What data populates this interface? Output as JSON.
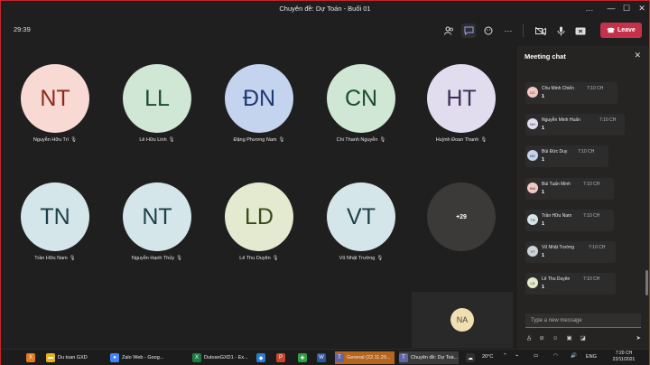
{
  "window": {
    "title": "Chuyên đề: Dự Toán - Buổi 01",
    "controls": [
      "…",
      "—",
      "☐",
      "✕"
    ]
  },
  "toolbar": {
    "timer": "29:39",
    "leave_label": "Leave",
    "icons": [
      "people-icon",
      "chat-icon",
      "reactions-icon",
      "more-icon",
      "camera-icon",
      "mic-icon",
      "share-icon"
    ]
  },
  "participants": [
    {
      "initials": "NT",
      "name": "Nguyễn Hữu Trí",
      "color": "#f9d9d3",
      "text": "#8a2b1a"
    },
    {
      "initials": "LL",
      "name": "Lê Hữu Linh",
      "color": "#cfe7d4",
      "text": "#1e4d2b"
    },
    {
      "initials": "ĐN",
      "name": "Đặng Phương Nam",
      "color": "#c4d3ee",
      "text": "#1e3a70"
    },
    {
      "initials": "CN",
      "name": "Chi Thanh Nguyễn",
      "color": "#cfe7d4",
      "text": "#1e4d2b"
    },
    {
      "initials": "HT",
      "name": "Huỳnh Đoan Thanh",
      "color": "#e1dcee",
      "text": "#3b2f5a"
    },
    {
      "initials": "TN",
      "name": "Trần Hữu Nam",
      "color": "#d5e6ea",
      "text": "#1e3f47"
    },
    {
      "initials": "NT",
      "name": "Nguyễn Hạnh Thủy",
      "color": "#d5e6ea",
      "text": "#1e3f47"
    },
    {
      "initials": "LD",
      "name": "Lê Thu Duyên",
      "color": "#e3ead0",
      "text": "#3a4a1a"
    },
    {
      "initials": "VT",
      "name": "Vũ Nhật Trường",
      "color": "#d5e6ea",
      "text": "#1e3f47"
    }
  ],
  "overflow": {
    "label": "+29"
  },
  "self_view": {
    "initials": "NA",
    "color": "#f2dfb1"
  },
  "chat": {
    "title": "Meeting chat",
    "messages": [
      {
        "initials": "CC",
        "author": "Chu Minh Chiến",
        "time": "7:10 CH",
        "text": "1",
        "color": "#f4c9c4"
      },
      {
        "initials": "NH",
        "author": "Nguyễn Minh Huấn",
        "time": "7:10 CH",
        "text": "1",
        "color": "#e1dcee"
      },
      {
        "initials": "BD",
        "author": "Bùi Đức Duy",
        "time": "7:10 CH",
        "text": "1",
        "color": "#c4d3ee"
      },
      {
        "initials": "BM",
        "author": "Bùi Tuấn Minh",
        "time": "7:10 CH",
        "text": "1",
        "color": "#f4c9c4"
      },
      {
        "initials": "TN",
        "author": "Trần Hữu Nam",
        "time": "7:10 CH",
        "text": "1",
        "color": "#d5e6ea"
      },
      {
        "initials": "VT",
        "author": "Vũ Nhật Trường",
        "time": "7:10 CH",
        "text": "1",
        "color": "#cfd4d8"
      },
      {
        "initials": "LD",
        "author": "Lê Thu Duyên",
        "time": "7:10 CH",
        "text": "1",
        "color": "#e3ead0"
      }
    ],
    "compose_placeholder": "Type a new message"
  },
  "taskbar": {
    "items": [
      {
        "label": "",
        "icon": "X",
        "color": "#e07b1f"
      },
      {
        "label": "Du toan GXD",
        "icon": "▬",
        "color": "#e8b21a"
      },
      {
        "label": "Zalo Web - Goog...",
        "icon": "●",
        "color": "#4285f4"
      },
      {
        "label": "DutoanGXD1 - Ex...",
        "icon": "X",
        "color": "#1f7a45"
      },
      {
        "label": "",
        "icon": "◆",
        "color": "#2b7cd3"
      },
      {
        "label": "",
        "icon": "P",
        "color": "#c4472b"
      },
      {
        "label": "",
        "icon": "✚",
        "color": "#2f9e44"
      },
      {
        "label": "",
        "icon": "W",
        "color": "#2b579a"
      },
      {
        "label": "General (22.11.20...",
        "icon": "T",
        "color": "#6264a7"
      },
      {
        "label": "Chuyên đề: Dự Toá...",
        "icon": "T",
        "color": "#6264a7"
      },
      {
        "label": "",
        "icon": "☁",
        "color": "#2f2f2f"
      }
    ],
    "weather": "20°C",
    "language": "ENG",
    "time": "7:20 CH",
    "date": "22/11/2021"
  }
}
